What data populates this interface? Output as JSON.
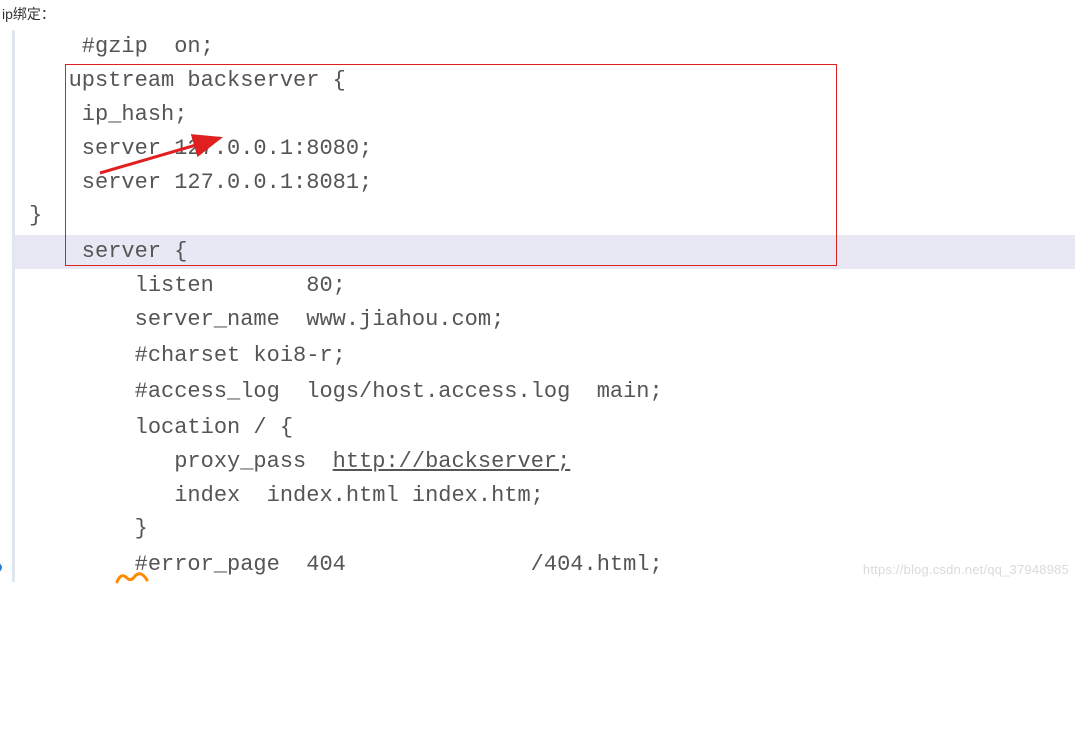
{
  "heading": "ip绑定：",
  "code": {
    "l1": "    #gzip  on;",
    "l2": "   upstream backserver {",
    "l3": "    ip_hash;",
    "l4": "    server 127.0.0.1:8080;",
    "l5": "    server 127.0.0.1:8081;",
    "l6": "}",
    "l7": "",
    "l8": "    server {",
    "l9": "        listen       80;",
    "l10": "        server_name  www.jiahou.com;",
    "l11": "",
    "l12": "        #charset koi8-r;",
    "l13": "",
    "l14": "        #access_log  logs/host.access.log  main;",
    "l15": "",
    "l16": "        location / {",
    "l17a": "           proxy_pass  ",
    "l17b": "http://backserver;",
    "l18": "           index  index.html index.htm;",
    "l19": "        }",
    "l20": "",
    "l21": "        #error_page  404              /404.html;"
  },
  "watermark": "https://blog.csdn.net/qq_37948985"
}
